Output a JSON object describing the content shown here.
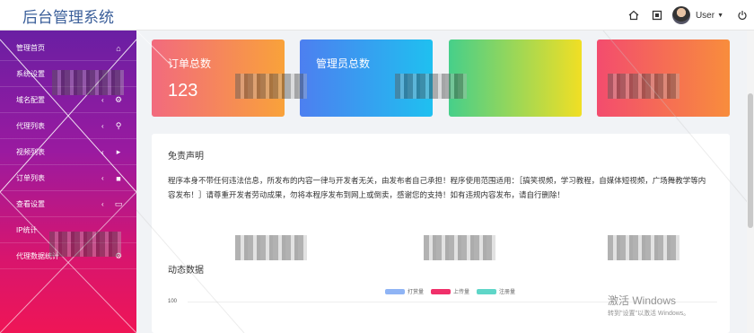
{
  "brand": {
    "title": "后台管理系统"
  },
  "topbar": {
    "home_icon": "home-icon",
    "fullscreen_icon": "fullscreen-icon",
    "user_label": "User",
    "power_icon": "power-icon"
  },
  "sidebar": {
    "items": [
      {
        "label": "管理首页",
        "arrow": "",
        "icon": "⌂"
      },
      {
        "label": "系统设置",
        "arrow": "",
        "icon": ""
      },
      {
        "label": "域名配置",
        "arrow": "‹",
        "icon": "⚙"
      },
      {
        "label": "代理列表",
        "arrow": "‹",
        "icon": "⚲"
      },
      {
        "label": "视频列表",
        "arrow": "‹",
        "icon": "▸"
      },
      {
        "label": "订单列表",
        "arrow": "‹",
        "icon": "■"
      },
      {
        "label": "查看设置",
        "arrow": "‹",
        "icon": "▭"
      },
      {
        "label": "IP统计",
        "arrow": "",
        "icon": ""
      },
      {
        "label": "代理数据统计",
        "arrow": "",
        "icon": "⚙"
      }
    ]
  },
  "cards": [
    {
      "title": "订单总数",
      "value": "123"
    },
    {
      "title": "管理员总数",
      "value": ""
    },
    {
      "title": "",
      "value": ""
    },
    {
      "title": "",
      "value": ""
    }
  ],
  "disclaimer": {
    "title": "免责声明",
    "text": "程序本身不带任何违法信息，所发布的内容一律与开发者无关，由发布者自己承担！程序使用范围适用：［搞笑视频，学习教程，自媒体短视频，广场舞教学等内容发布！］请尊重开发者劳动成果，勿将本程序发布到网上或倒卖，感谢您的支持！如有违规内容发布，请自行删除！"
  },
  "chart": {
    "title": "动态数据",
    "ytick": "100",
    "legend": [
      {
        "name": "打赏量",
        "color": "#8fb4f5"
      },
      {
        "name": "上传量",
        "color": "#f0306a"
      },
      {
        "name": "注册量",
        "color": "#5fd6c8"
      }
    ]
  },
  "activation": {
    "line1": "激活 Windows",
    "line2": "转到\"设置\"以激活 Windows。"
  }
}
